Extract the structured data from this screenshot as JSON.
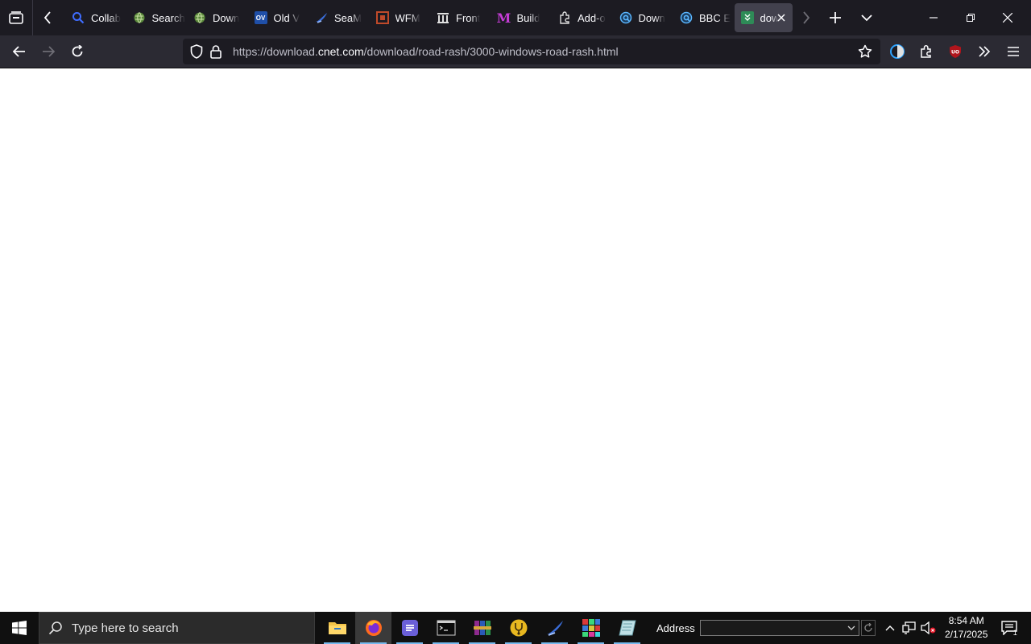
{
  "browser": {
    "tabs": [
      {
        "label": "Collab",
        "icon": "search-icon",
        "color": "#3f6dff"
      },
      {
        "label": "Search",
        "icon": "globe-icon",
        "color": "#8bb05a"
      },
      {
        "label": "Down",
        "icon": "globe-icon",
        "color": "#8bb05a"
      },
      {
        "label": "Old V",
        "icon": "ov-icon",
        "color": "#1f4fa8",
        "icon_text": "OV"
      },
      {
        "label": "SeaM",
        "icon": "seamonkey-icon",
        "color": "#3a6dd8"
      },
      {
        "label": "WFM",
        "icon": "wfm-icon",
        "color": "#c04a2a"
      },
      {
        "label": "Front",
        "icon": "columns-icon",
        "color": "#e0e0e0"
      },
      {
        "label": "Build",
        "icon": "m-icon",
        "color": "#c53cd6",
        "icon_text": "M"
      },
      {
        "label": "Add-o",
        "icon": "puzzle-icon",
        "color": "#e0e0e0"
      },
      {
        "label": "Down",
        "icon": "q-icon",
        "color": "#5ab6ff"
      },
      {
        "label": "BBC E",
        "icon": "q-icon",
        "color": "#5ab6ff"
      },
      {
        "label": "dow",
        "icon": "download-icon",
        "color": "#2e8b57",
        "active": true
      }
    ],
    "url_prefix": "https://download.",
    "url_domain": "cnet.com",
    "url_path": "/download/road-rash/3000-windows-road-rash.html"
  },
  "taskbar": {
    "search_placeholder": "Type here to search",
    "address_label": "Address",
    "address_value": "",
    "time": "8:54 AM",
    "date": "2/17/2025",
    "notification_count": "1"
  }
}
